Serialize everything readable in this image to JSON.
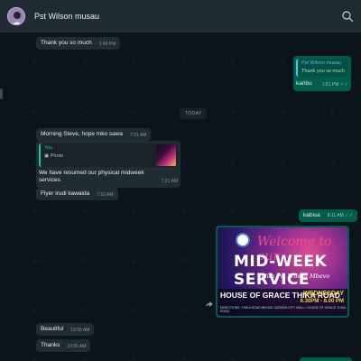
{
  "header": {
    "contact_name": "Pst Wilson musau",
    "avatar_icon": "avatar-photo",
    "search_icon": "search-icon"
  },
  "messages": [
    {
      "dir": "in",
      "text": "Thank you so much",
      "time": "1:49 PM"
    },
    {
      "dir": "out",
      "quote_author": "Pst Wilson musau",
      "quote_text": "Thank you so much",
      "text": "karibu",
      "time": "1:51 PM"
    },
    {
      "dir": "in",
      "text": "Morning Steve, hope mko sawa",
      "time": "7:21 AM"
    },
    {
      "dir": "in",
      "quote_author": "You",
      "quote_text": "Photo",
      "text": "We have resumed our physical midweek services",
      "time": "7:21 AM"
    },
    {
      "dir": "in",
      "text": "Flyer irudi kawaida",
      "time": "7:22 AM"
    },
    {
      "dir": "out",
      "text": "kabisa",
      "time": "8:11 AM"
    },
    {
      "dir": "in",
      "text": "Beautiful",
      "time": "10:55 AM"
    },
    {
      "dir": "in",
      "text": "Thanks",
      "time": "10:55 AM"
    }
  ],
  "day_separator": "TODAY",
  "poster": {
    "welcome": "Welcome to our",
    "title": "MID-WEEK SERVICE",
    "with": "With Pst Wilson Mbevo",
    "house": "HOUSE OF GRACE THIKA ROAD",
    "day": "WEDNESDAY",
    "time": "6.30PM - 8.00 PM",
    "info": "DIRECTIONS: THIKA ROAD BESIDE GARDEN CITY MALL • HOUSE OF GRACE THIKA ROAD"
  },
  "colors": {
    "incoming_bubble": "#202c33",
    "outgoing_bubble": "#005c4b",
    "read_ticks": "#53bdeb",
    "background": "#0b141a"
  }
}
